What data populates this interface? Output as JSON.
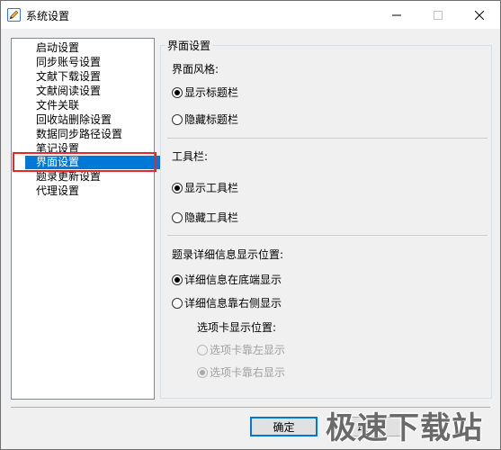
{
  "window": {
    "title": "系统设置"
  },
  "sidebar": {
    "items": [
      {
        "label": "启动设置"
      },
      {
        "label": "同步账号设置"
      },
      {
        "label": "文献下载设置"
      },
      {
        "label": "文献阅读设置"
      },
      {
        "label": "文件关联"
      },
      {
        "label": "回收站删除设置"
      },
      {
        "label": "数据同步路径设置"
      },
      {
        "label": "笔记设置"
      },
      {
        "label": "界面设置"
      },
      {
        "label": "题录更新设置"
      },
      {
        "label": "代理设置"
      }
    ],
    "selected": "界面设置"
  },
  "panel": {
    "title": "界面设置",
    "style_section": {
      "label": "界面风格:",
      "options": [
        {
          "label": "显示标题栏",
          "checked": true
        },
        {
          "label": "隐藏标题栏",
          "checked": false
        }
      ]
    },
    "toolbar_section": {
      "label": "工具栏:",
      "options": [
        {
          "label": "显示工具栏",
          "checked": true
        },
        {
          "label": "隐藏工具栏",
          "checked": false
        }
      ]
    },
    "detail_section": {
      "label": "题录详细信息显示位置:",
      "options": [
        {
          "label": "详细信息在底端显示",
          "checked": true
        },
        {
          "label": "详细信息靠右侧显示",
          "checked": false
        }
      ],
      "tab_label": "选项卡显示位置:",
      "tab_options": [
        {
          "label": "选项卡靠左显示",
          "checked": false,
          "disabled": true
        },
        {
          "label": "选项卡靠右显示",
          "checked": true,
          "disabled": true
        }
      ]
    }
  },
  "buttons": {
    "ok": "确定",
    "cancel": "取消"
  },
  "watermark": "极速下载站",
  "colors": {
    "selection": "#0078d7",
    "highlight_outline": "#e8262b"
  }
}
